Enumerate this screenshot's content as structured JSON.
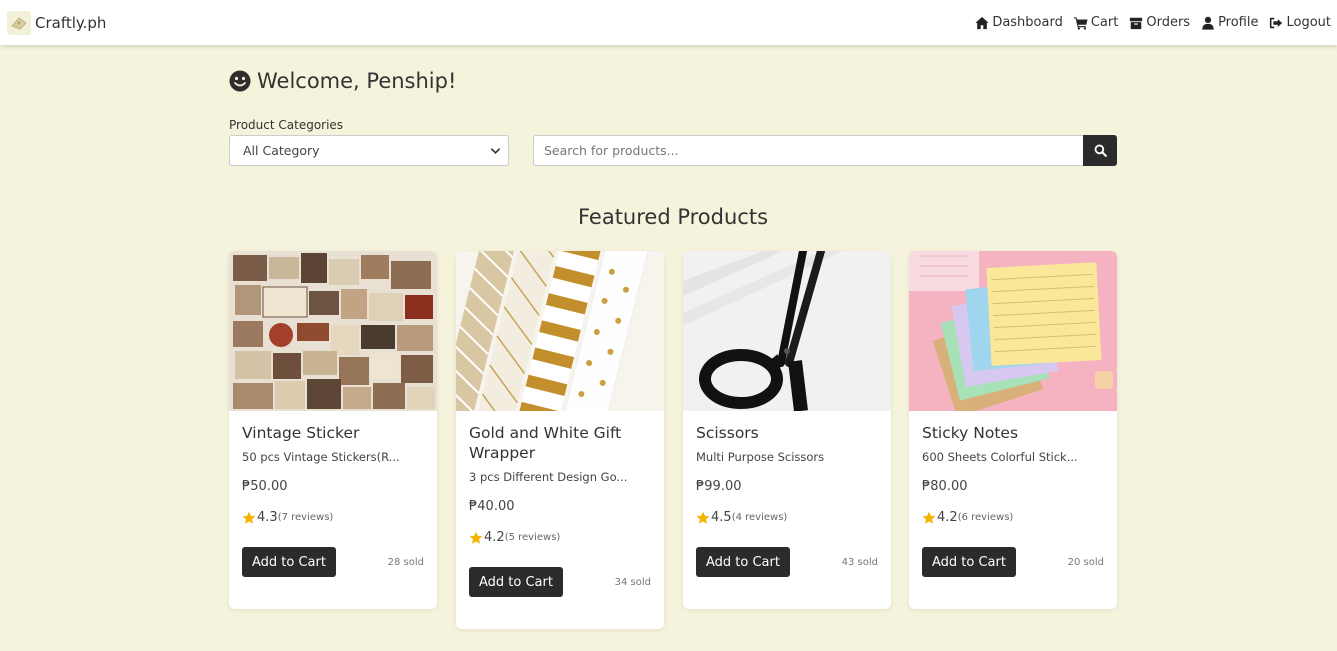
{
  "navbar": {
    "brand": "Craftly.ph",
    "links": [
      {
        "label": "Dashboard",
        "icon": "home-icon"
      },
      {
        "label": "Cart",
        "icon": "cart-icon"
      },
      {
        "label": "Orders",
        "icon": "box-icon"
      },
      {
        "label": "Profile",
        "icon": "user-icon"
      },
      {
        "label": "Logout",
        "icon": "logout-icon"
      }
    ]
  },
  "welcome": "Welcome, Penship!",
  "filters": {
    "category_label": "Product Categories",
    "category_selected": "All Category",
    "search_placeholder": "Search for products..."
  },
  "featured_title": "Featured Products",
  "products": [
    {
      "name": "Vintage Sticker",
      "desc": "50 pcs Vintage Stickers(R...",
      "price": "₱50.00",
      "rating": "4.3",
      "reviews": "(7 reviews)",
      "button": "Add to Cart",
      "sold": "28 sold"
    },
    {
      "name": "Gold and White Gift Wrapper",
      "desc": "3 pcs Different Design Go...",
      "price": "₱40.00",
      "rating": "4.2",
      "reviews": "(5 reviews)",
      "button": "Add to Cart",
      "sold": "34 sold"
    },
    {
      "name": "Scissors",
      "desc": "Multi Purpose Scissors",
      "price": "₱99.00",
      "rating": "4.5",
      "reviews": "(4 reviews)",
      "button": "Add to Cart",
      "sold": "43 sold"
    },
    {
      "name": "Sticky Notes",
      "desc": "600 Sheets Colorful Stick...",
      "price": "₱80.00",
      "rating": "4.2",
      "reviews": "(6 reviews)",
      "button": "Add to Cart",
      "sold": "20 sold"
    }
  ],
  "colors": {
    "background": "#f5f3dc",
    "button": "#2b2b2b",
    "star": "#f5b400"
  }
}
